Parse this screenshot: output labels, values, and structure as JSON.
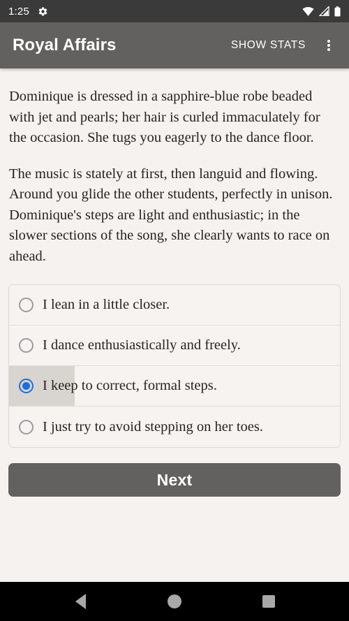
{
  "status_bar": {
    "clock": "1:25",
    "icons": [
      "gear-icon",
      "wifi-icon",
      "cellular-signal-icon",
      "battery-icon"
    ]
  },
  "app_bar": {
    "title": "Royal Affairs",
    "show_stats_label": "SHOW STATS",
    "overflow_label": "More options",
    "background_color": "#636160"
  },
  "story": {
    "paragraphs": [
      "Dominique is dressed in a sapphire-blue robe beaded with jet and pearls; her hair is curled immaculately for the occasion. She tugs you eagerly to the dance floor.",
      "The music is stately at first, then languid and flowing. Around you glide the other students, perfectly in unison. Dominique's steps are light and enthusiastic; in the slower sections of the song, she clearly wants to race on ahead."
    ]
  },
  "choices": {
    "selected_index": 2,
    "selected_color": "#1a6fe0",
    "options": [
      {
        "label": "I lean in a little closer.",
        "selected": false
      },
      {
        "label": "I dance enthusiastically and freely.",
        "selected": false
      },
      {
        "label": "I keep to correct, formal steps.",
        "selected": true
      },
      {
        "label": "I just try to avoid stepping on her toes.",
        "selected": false
      }
    ]
  },
  "next_button": {
    "label": "Next",
    "background_color": "#636160"
  },
  "nav_bar": {
    "back_label": "Back",
    "home_label": "Home",
    "recents_label": "Recent apps"
  },
  "theme": {
    "page_background": "#f6f2ef",
    "text_color": "#26231f"
  }
}
